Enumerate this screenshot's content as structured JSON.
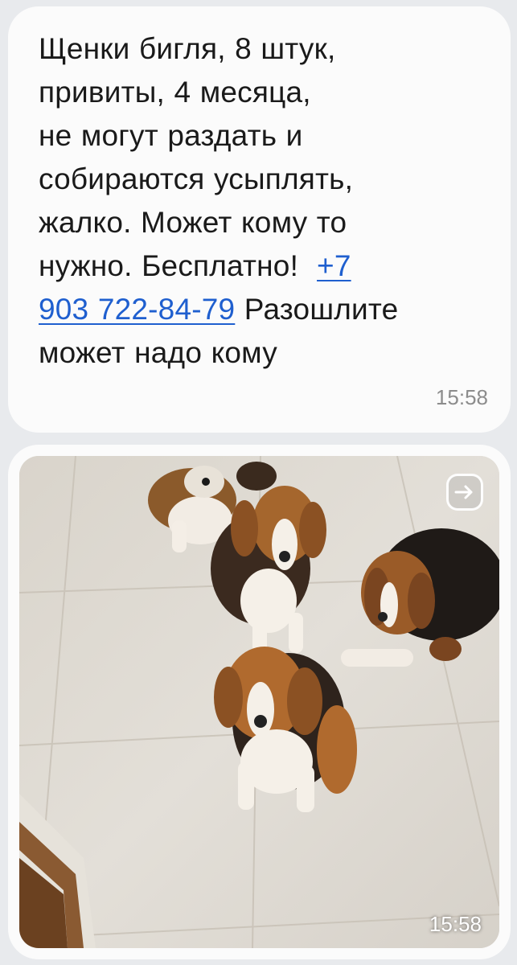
{
  "message_text": {
    "segments": [
      "Щенки бигля, 8 штук,",
      "привиты, 4 месяца,",
      "не могут раздать и",
      "собираются усыплять,",
      "жалко. Может кому то",
      "нужно.  Бесплатно!"
    ],
    "phone_part1": "+7",
    "phone_part2": "903 722-84-79",
    "after_phone": " Разошлите",
    "last_line": "может надо кому",
    "time": "15:58"
  },
  "image_message": {
    "icons": {
      "forward": "forward-arrow-icon"
    },
    "time": "15:58"
  },
  "colors": {
    "link": "#1f5fcf",
    "bubble": "#fbfbfb",
    "background": "#e8eaed",
    "timestamp": "#8c8c8c"
  }
}
